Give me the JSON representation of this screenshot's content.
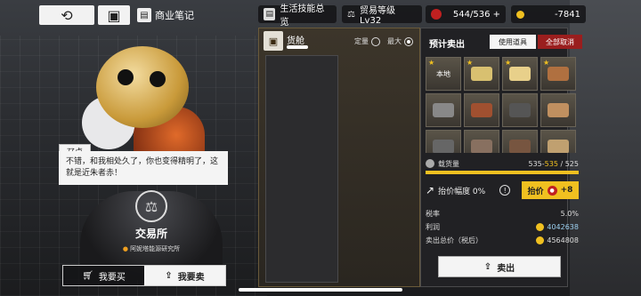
{
  "topbar": {
    "back_icon": "undo-arrow-icon",
    "train_icon": "train-icon",
    "notes_label": "商业笔记",
    "skills_label": "生活技能总览",
    "trade_level_label": "贸易等级Lv32",
    "stamina": "544/536 +",
    "currency": "-7841"
  },
  "dialog": {
    "speaker": "孖卓",
    "text": "不错，和我相处久了，你也变得精明了，这就是近朱者赤！"
  },
  "station": {
    "name": "交易所",
    "location": "阿妮塔能源研究所"
  },
  "tabs": {
    "buy": "我要买",
    "sell": "我要卖"
  },
  "cargo": {
    "title": "货舱",
    "mode_fixed": "定量",
    "mode_max": "最大"
  },
  "sell": {
    "title": "预计卖出",
    "use_item": "使用道具",
    "cancel_all": "全部取消",
    "items": [
      {
        "label": "本地",
        "color": "#444"
      },
      {
        "label": "",
        "color": "#d8c070"
      },
      {
        "label": "",
        "color": "#e8d08a"
      },
      {
        "label": "",
        "color": "#b07040"
      },
      {
        "label": "",
        "color": "#888"
      },
      {
        "label": "",
        "color": "#a05030"
      },
      {
        "label": "",
        "color": "#555"
      },
      {
        "label": "",
        "color": "#c09060"
      },
      {
        "label": "",
        "color": "#666"
      },
      {
        "label": "",
        "color": "#887060"
      },
      {
        "label": "",
        "color": "#775540"
      },
      {
        "label": "",
        "color": "#c0a070"
      }
    ],
    "capacity_label": "载货量",
    "capacity_used": "535",
    "capacity_mid": "535",
    "capacity_max": "525",
    "capacity_fill": 1.0,
    "haggle_label": "抬价幅度 0%",
    "haggle_button": "抬价",
    "haggle_cost": "+8",
    "tax_label": "税率",
    "tax_value": "5.0%",
    "profit_label": "利润",
    "profit_value": "4042638",
    "total_label": "卖出总价（税后）",
    "total_value": "4564808",
    "sell_button": "卖出"
  }
}
